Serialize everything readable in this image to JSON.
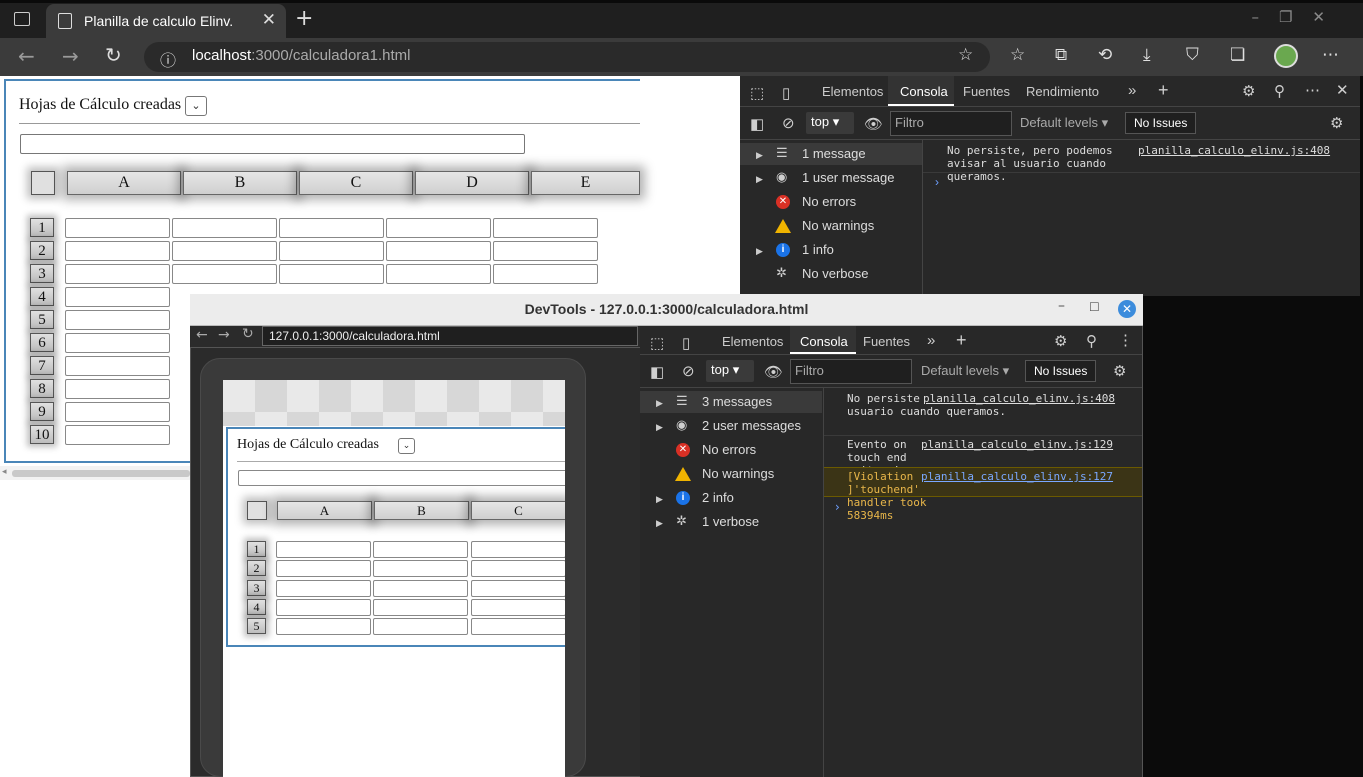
{
  "browser": {
    "tab_title": "Planilla de calculo Elinv.",
    "url_host": "localhost",
    "url_rest": ":3000/calculadora1.html"
  },
  "sheet": {
    "title": "Hojas de Cálculo creadas",
    "columns": [
      "A",
      "B",
      "C",
      "D",
      "E"
    ],
    "rows": [
      "1",
      "2",
      "3",
      "4",
      "5",
      "6",
      "7",
      "8",
      "9",
      "10"
    ]
  },
  "devtools_docked": {
    "tabs": [
      "Elementos",
      "Consola",
      "Fuentes",
      "Rendimiento"
    ],
    "active_tab": "Consola",
    "context": "top",
    "filter_placeholder": "Filtro",
    "levels": "Default levels",
    "issues": "No Issues",
    "sidebar": [
      "1 message",
      "1 user message",
      "No errors",
      "No warnings",
      "1 info",
      "No verbose"
    ],
    "messages": [
      {
        "text": "No persiste, pero podemos avisar al usuario cuando queramos.",
        "source": "planilla_calculo_elinv.js:408"
      }
    ]
  },
  "devtools_window": {
    "title": "DevTools - 127.0.0.1:3000/calculadora.html",
    "emulated_url": "127.0.0.1:3000/calculadora.html",
    "tabs": [
      "Elementos",
      "Consola",
      "Fuentes"
    ],
    "active_tab": "Consola",
    "context": "top",
    "filter_placeholder": "Filtro",
    "levels": "Default levels",
    "issues": "No Issues",
    "sidebar": [
      "3 messages",
      "2 user messages",
      "No errors",
      "No warnings",
      "2 info",
      "1 verbose"
    ],
    "messages": [
      {
        "text": "No persiste, pero podemos avisar al usuario cuando queramos.",
        "source": "planilla_calculo_elinv.js:408"
      },
      {
        "text": "Evento on touch end exitoso!",
        "source": "planilla_calculo_elinv.js:129"
      },
      {
        "text": "[Violation ]'touchend' handler took 58394ms",
        "source": "planilla_calculo_elinv.js:127"
      }
    ],
    "mobile_sheet": {
      "title": "Hojas de Cálculo creadas",
      "columns": [
        "A",
        "B",
        "C"
      ],
      "rows": [
        "1",
        "2",
        "3",
        "4",
        "5"
      ]
    }
  }
}
